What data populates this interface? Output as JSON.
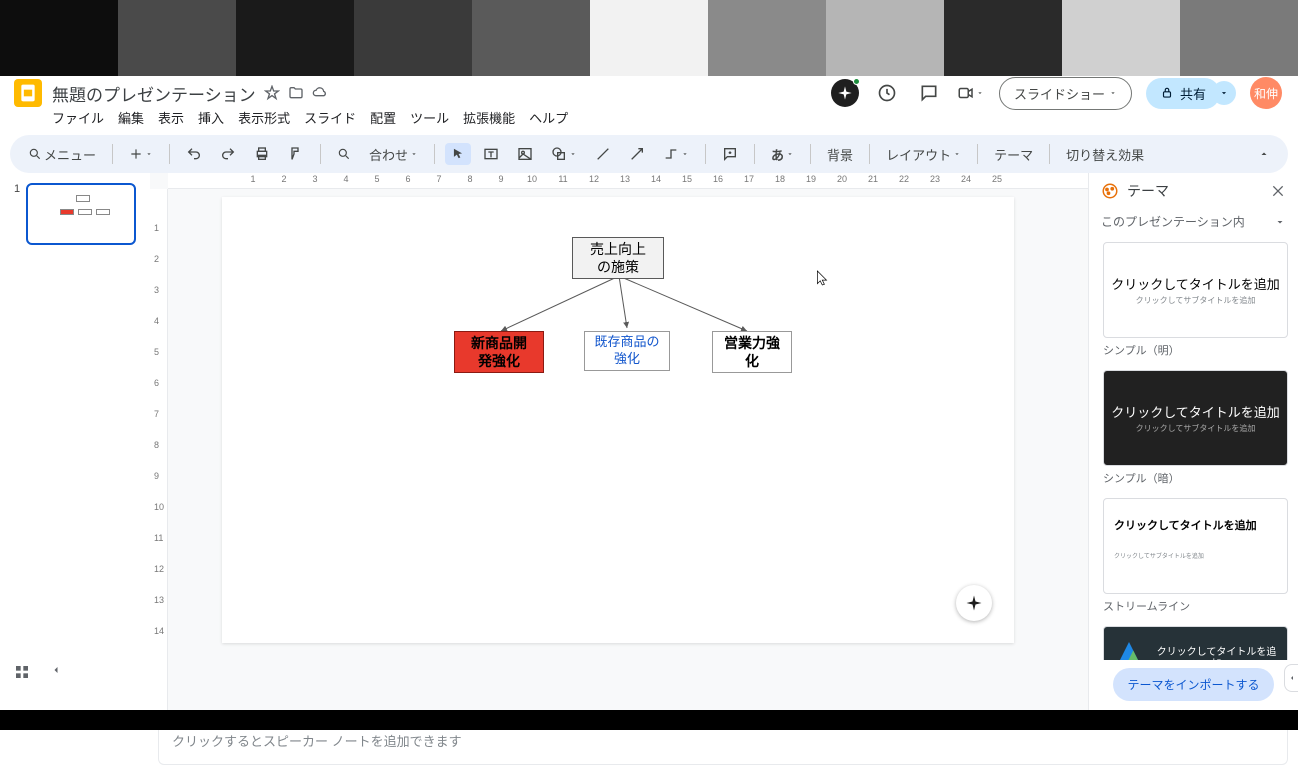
{
  "doc": {
    "title": "無題のプレゼンテーション"
  },
  "menu": {
    "file": "ファイル",
    "edit": "編集",
    "view": "表示",
    "insert": "挿入",
    "format": "表示形式",
    "slide": "スライド",
    "arrange": "配置",
    "tools": "ツール",
    "extensions": "拡張機能",
    "help": "ヘルプ"
  },
  "toolbar": {
    "search_label": "メニュー",
    "fit": "合わせ",
    "background": "背景",
    "layout": "レイアウト",
    "theme": "テーマ",
    "transition": "切り替え効果"
  },
  "header_buttons": {
    "slideshow": "スライドショー",
    "share": "共有"
  },
  "avatar": {
    "text": "和伸"
  },
  "diagram": {
    "root": "売上向上\nの施策",
    "child1": "新商品開\n発強化",
    "child2": "既存商品の\n強化",
    "child3": "営業力強\n化"
  },
  "notes": {
    "placeholder": "クリックするとスピーカー ノートを追加できます"
  },
  "theme_panel": {
    "title": "テーマ",
    "section": "このプレゼンテーション内",
    "card_title": "クリックしてタイトルを追加",
    "card_sub": "クリックしてサブタイトルを追加",
    "card_sub2": "クリックしてサブタイトルを追加",
    "label_light": "シンプル（明）",
    "label_dark": "シンプル（暗）",
    "label_stream": "ストリームライン",
    "import": "テーマをインポートする",
    "focus_title": "クリックしてタイトルを追加"
  },
  "ruler_h": [
    "1",
    "2",
    "3",
    "4",
    "5",
    "6",
    "7",
    "8",
    "9",
    "10",
    "11",
    "12",
    "13",
    "14",
    "15",
    "16",
    "17",
    "18",
    "19",
    "20",
    "21",
    "22",
    "23",
    "24",
    "25"
  ],
  "ruler_v": [
    "1",
    "2",
    "3",
    "4",
    "5",
    "6",
    "7",
    "8",
    "9",
    "10",
    "11",
    "12",
    "13",
    "14"
  ],
  "slide_number": "1"
}
